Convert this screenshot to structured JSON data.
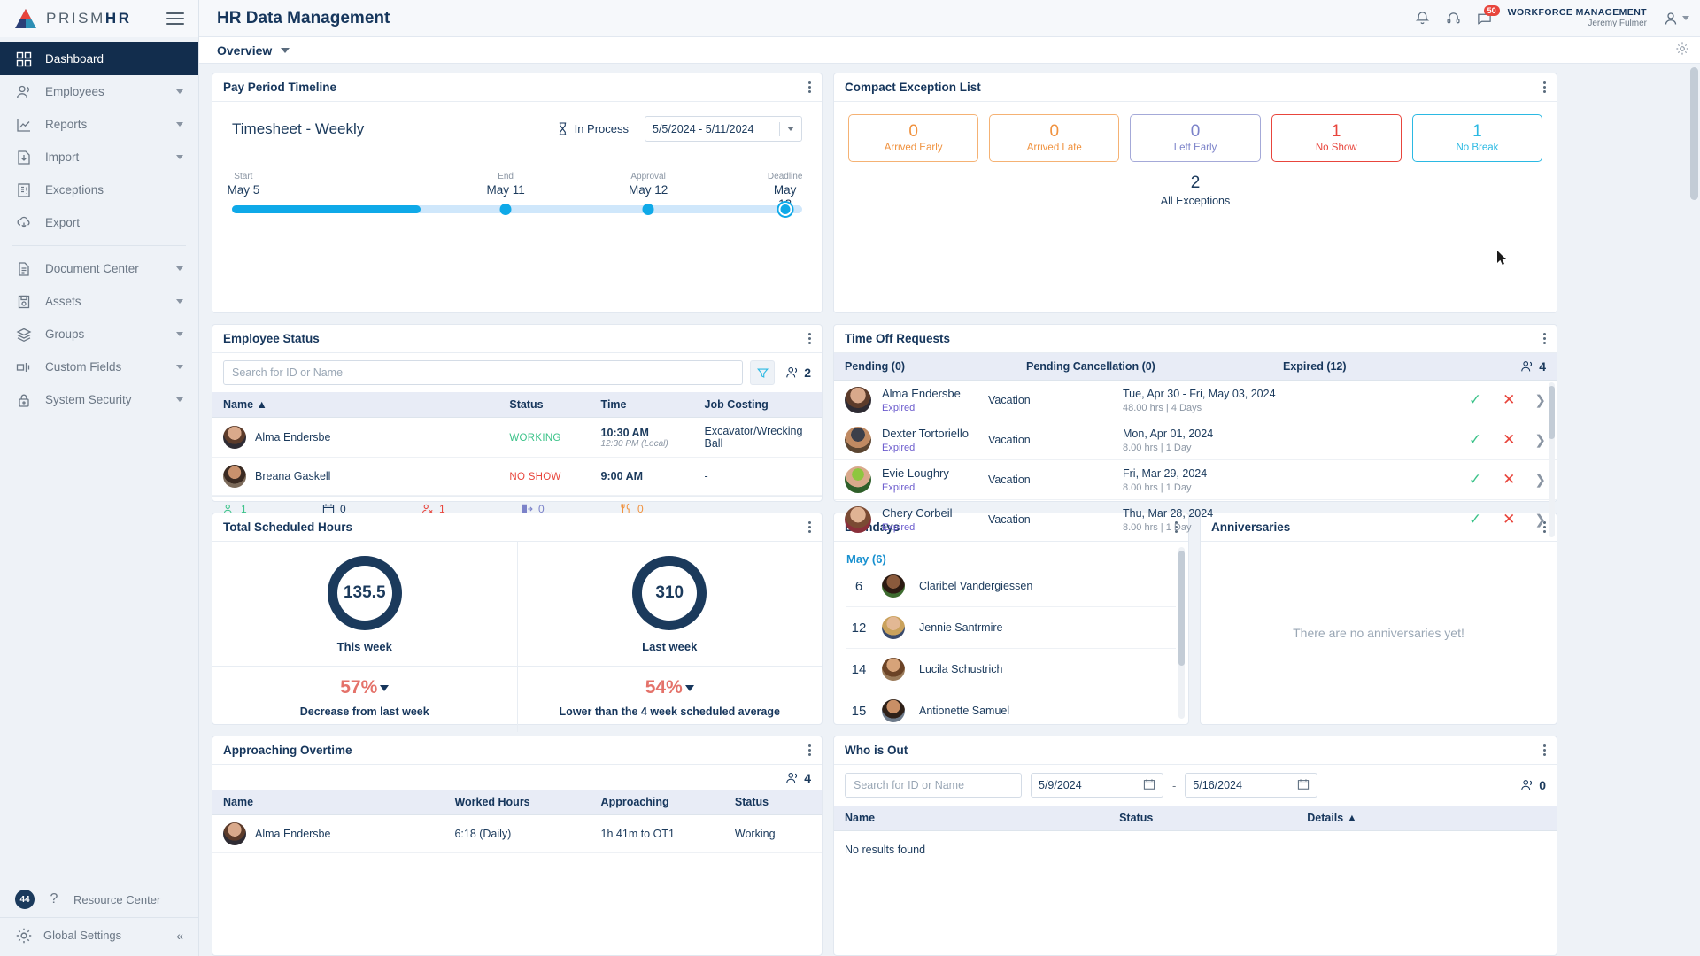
{
  "brand": {
    "name_light": "PRISM",
    "name_bold": "HR"
  },
  "header": {
    "title": "HR Data Management",
    "notification_badge": "50",
    "workforce_label": "WORKFORCE MANAGEMENT",
    "user_name": "Jeremy Fulmer"
  },
  "subbar": {
    "tab": "Overview"
  },
  "sidebar": {
    "items": [
      {
        "label": "Dashboard",
        "icon": "grid-icon",
        "active": true,
        "expandable": false
      },
      {
        "label": "Employees",
        "icon": "people-icon",
        "active": false,
        "expandable": true
      },
      {
        "label": "Reports",
        "icon": "chart-icon",
        "active": false,
        "expandable": true
      },
      {
        "label": "Import",
        "icon": "import-icon",
        "active": false,
        "expandable": true
      },
      {
        "label": "Exceptions",
        "icon": "exception-icon",
        "active": false,
        "expandable": false
      },
      {
        "label": "Export",
        "icon": "export-cloud-icon",
        "active": false,
        "expandable": false
      },
      {
        "label": "Document Center",
        "icon": "document-icon",
        "active": false,
        "expandable": true
      },
      {
        "label": "Assets",
        "icon": "assets-icon",
        "active": false,
        "expandable": true
      },
      {
        "label": "Groups",
        "icon": "layers-icon",
        "active": false,
        "expandable": true
      },
      {
        "label": "Custom Fields",
        "icon": "custom-fields-icon",
        "active": false,
        "expandable": true
      },
      {
        "label": "System Security",
        "icon": "lock-icon",
        "active": false,
        "expandable": true
      }
    ],
    "resource_center": {
      "label": "Resource Center",
      "badge": "44"
    },
    "global_settings": {
      "label": "Global Settings"
    }
  },
  "pay_period": {
    "title": "Pay Period Timeline",
    "timesheet_label": "Timesheet - Weekly",
    "status": "In Process",
    "date_range": "5/5/2024 - 5/11/2024",
    "milestones": [
      {
        "label": "Start",
        "date": "May 5",
        "pos": 0
      },
      {
        "label": "End",
        "date": "May 11",
        "pos": 50
      },
      {
        "label": "Approval",
        "date": "May 12",
        "pos": 75
      },
      {
        "label": "Deadline",
        "date": "May 13",
        "pos": 100
      }
    ],
    "progress_pct": 35
  },
  "exceptions": {
    "title": "Compact Exception List",
    "cards": [
      {
        "count": "0",
        "label": "Arrived Early",
        "color": "#f0923f"
      },
      {
        "count": "0",
        "label": "Arrived Late",
        "color": "#f0923f"
      },
      {
        "count": "0",
        "label": "Left Early",
        "color": "#7b82c9"
      },
      {
        "count": "1",
        "label": "No Show",
        "color": "#e8453c"
      },
      {
        "count": "1",
        "label": "No Break",
        "color": "#2bb9e3"
      }
    ],
    "total_count": "2",
    "total_label": "All Exceptions"
  },
  "employee_status": {
    "title": "Employee Status",
    "search_placeholder": "Search for ID or Name",
    "count": "2",
    "columns": [
      "Name",
      "Status",
      "Time",
      "Job Costing"
    ],
    "rows": [
      {
        "name": "Alma Endersbe",
        "status": "WORKING",
        "status_type": "working",
        "time": "10:30 AM",
        "time_sub": "12:30 PM (Local)",
        "job": "Excavator/Wrecking Ball"
      },
      {
        "name": "Breana Gaskell",
        "status": "NO SHOW",
        "status_type": "noshow",
        "time": "9:00 AM",
        "time_sub": "",
        "job": "-"
      }
    ],
    "footer_stats": [
      {
        "icon": "person-check-icon",
        "value": "1",
        "color": "#3dc38a"
      },
      {
        "icon": "calendar-icon",
        "value": "0",
        "color": "#16365c"
      },
      {
        "icon": "person-x-icon",
        "value": "1",
        "color": "#e8453c"
      },
      {
        "icon": "exit-icon",
        "value": "0",
        "color": "#7b82c9"
      },
      {
        "icon": "meal-icon",
        "value": "0",
        "color": "#f0923f"
      }
    ]
  },
  "time_off": {
    "title": "Time Off Requests",
    "tabs": [
      "Pending (0)",
      "Pending Cancellation (0)",
      "Expired (12)"
    ],
    "count": "4",
    "rows": [
      {
        "name": "Alma Endersbe",
        "state": "Expired",
        "type": "Vacation",
        "dates": "Tue, Apr 30 - Fri, May 03, 2024",
        "hours": "48.00 hrs | 4 Days"
      },
      {
        "name": "Dexter Tortoriello",
        "state": "Expired",
        "type": "Vacation",
        "dates": "Mon, Apr 01, 2024",
        "hours": "8.00 hrs | 1 Day"
      },
      {
        "name": "Evie Loughry",
        "state": "Expired",
        "type": "Vacation",
        "dates": "Fri, Mar 29, 2024",
        "hours": "8.00 hrs | 1 Day"
      },
      {
        "name": "Chery Corbeil",
        "state": "Expired",
        "type": "Vacation",
        "dates": "Thu, Mar 28, 2024",
        "hours": "8.00 hrs | 1 Day"
      }
    ]
  },
  "scheduled_hours": {
    "title": "Total Scheduled Hours",
    "panels": [
      {
        "value": "135.5",
        "label": "This week",
        "pct": "57%",
        "pct_label": "Decrease from last week"
      },
      {
        "value": "310",
        "label": "Last week",
        "pct": "54%",
        "pct_label": "Lower than the 4 week scheduled average"
      }
    ]
  },
  "birthdays": {
    "title": "Birthdays",
    "month_label": "May (6)",
    "rows": [
      {
        "day": "6",
        "name": "Claribel Vandergiessen"
      },
      {
        "day": "12",
        "name": "Jennie Santrmire"
      },
      {
        "day": "14",
        "name": "Lucila Schustrich"
      },
      {
        "day": "15",
        "name": "Antionette Samuel"
      }
    ]
  },
  "anniversaries": {
    "title": "Anniversaries",
    "empty_message": "There are no anniversaries yet!"
  },
  "overtime": {
    "title": "Approaching Overtime",
    "count": "4",
    "columns": [
      "Name",
      "Worked Hours",
      "Approaching",
      "Status"
    ],
    "rows": [
      {
        "name": "Alma Endersbe",
        "worked": "6:18 (Daily)",
        "approaching": "1h 41m to OT1",
        "status": "Working"
      }
    ]
  },
  "who_is_out": {
    "title": "Who is Out",
    "search_placeholder": "Search for ID or Name",
    "date_from": "5/9/2024",
    "date_to": "5/16/2024",
    "count": "0",
    "columns": [
      "Name",
      "Status",
      "Details"
    ],
    "empty_message": "No results found"
  }
}
